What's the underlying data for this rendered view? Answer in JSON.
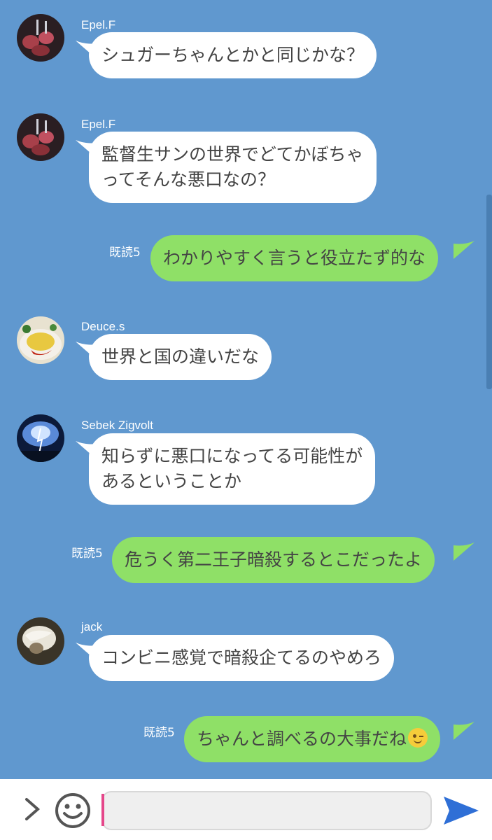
{
  "messages": [
    {
      "type": "in",
      "sender": "Epel.F",
      "avatar": "grilled-meat-avatar",
      "lines": [
        "シュガーちゃんとかと同じかな？"
      ]
    },
    {
      "type": "in",
      "sender": "Epel.F",
      "avatar": "grilled-meat-avatar",
      "lines": [
        "監督生サンの世界でどてかぼちゃ",
        "ってそんな悪口なの？"
      ]
    },
    {
      "type": "out",
      "read": "既読5",
      "lines": [
        "わかりやすく言うと役立たず的な"
      ]
    },
    {
      "type": "in",
      "sender": "Deuce.s",
      "avatar": "omelette-rice-avatar",
      "lines": [
        "世界と国の違いだな"
      ]
    },
    {
      "type": "in",
      "sender": "Sebek Zigvolt",
      "avatar": "lightning-sky-avatar",
      "lines": [
        "知らずに悪口になってる可能性が",
        "あるということか"
      ]
    },
    {
      "type": "out",
      "read": "既読5",
      "lines": [
        "危うく第二王子暗殺するとこだったよ"
      ]
    },
    {
      "type": "in",
      "sender": "jack",
      "avatar": "white-fur-avatar",
      "lines": [
        "コンビニ感覚で暗殺企てるのやめろ"
      ]
    },
    {
      "type": "out",
      "read": "既読5",
      "lines": [
        "ちゃんと調べるの大事だね"
      ],
      "emoji": "wink-emoji"
    }
  ],
  "input": {
    "value": "",
    "placeholder": ""
  },
  "icons": {
    "expand": "chevron-right-icon",
    "sticker": "smiley-icon",
    "send": "send-icon"
  },
  "colors": {
    "background": "#6098cf",
    "outgoing": "#8fe067",
    "incoming": "#ffffff",
    "caret": "#e5478a",
    "send": "#2f6fd6"
  }
}
